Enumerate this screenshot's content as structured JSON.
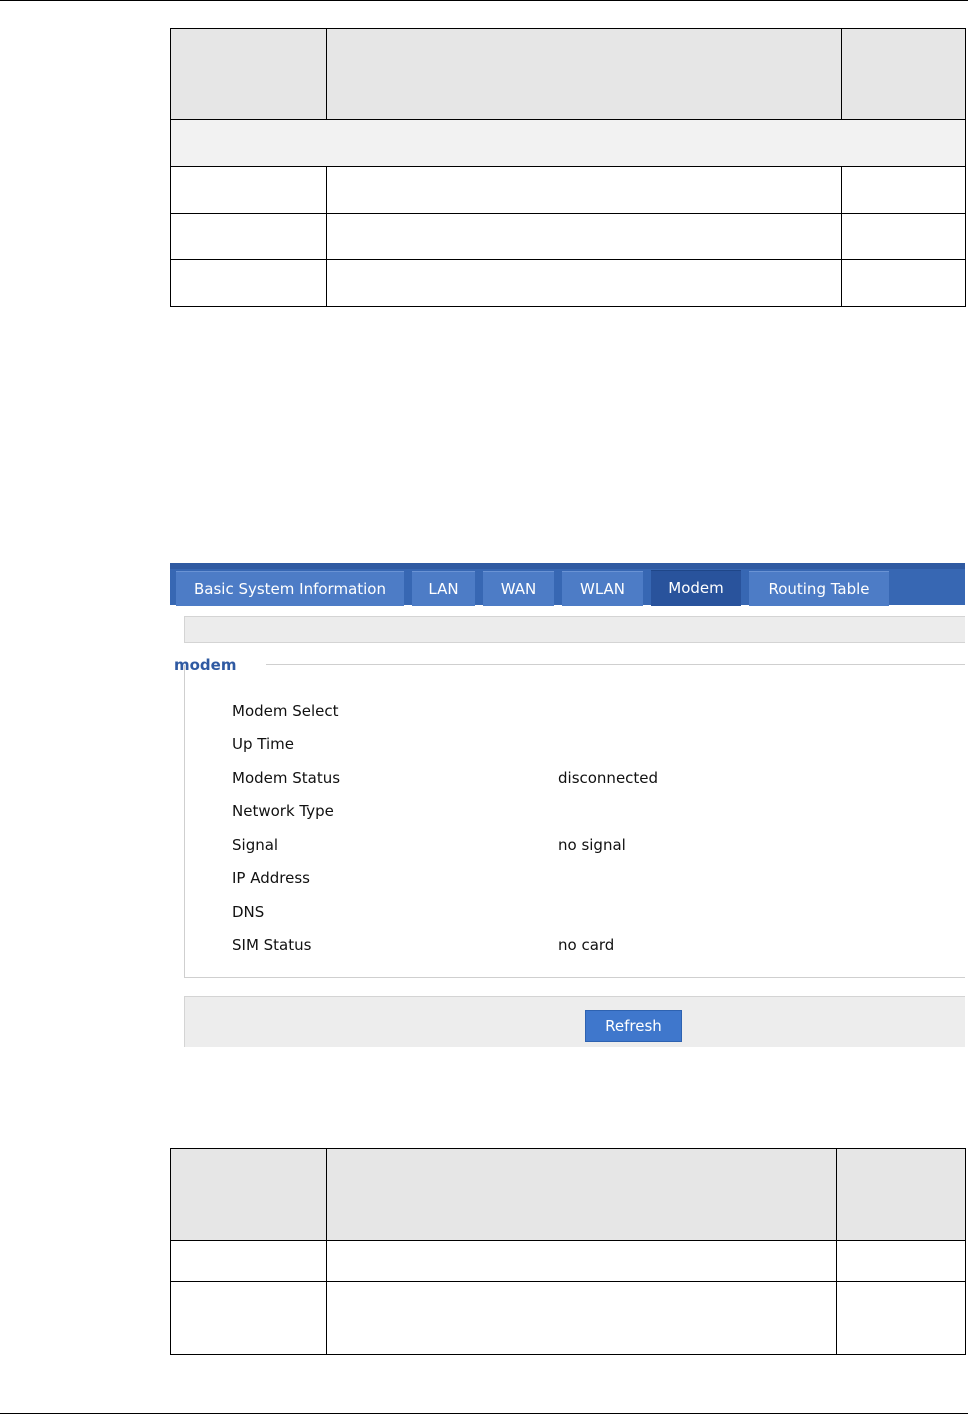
{
  "router": {
    "tabs": [
      {
        "label": "Basic System Information"
      },
      {
        "label": "LAN"
      },
      {
        "label": "WAN"
      },
      {
        "label": "WLAN"
      },
      {
        "label": "Modem",
        "active": true
      },
      {
        "label": "Routing Table"
      }
    ],
    "section_title": "modem",
    "fields": [
      {
        "label": "Modem Select",
        "value": ""
      },
      {
        "label": "Up Time",
        "value": ""
      },
      {
        "label": "Modem Status",
        "value": "disconnected"
      },
      {
        "label": "Network Type",
        "value": ""
      },
      {
        "label": "Signal",
        "value": "no signal"
      },
      {
        "label": "IP Address",
        "value": ""
      },
      {
        "label": "DNS",
        "value": ""
      },
      {
        "label": "SIM Status",
        "value": "no card"
      }
    ],
    "refresh_label": "Refresh"
  },
  "colors": {
    "tab_bar": "#3767b3",
    "tab": "#4d7cc6",
    "tab_active": "#29539c",
    "section_title": "#2f5aa2",
    "button": "#3f77cc"
  }
}
